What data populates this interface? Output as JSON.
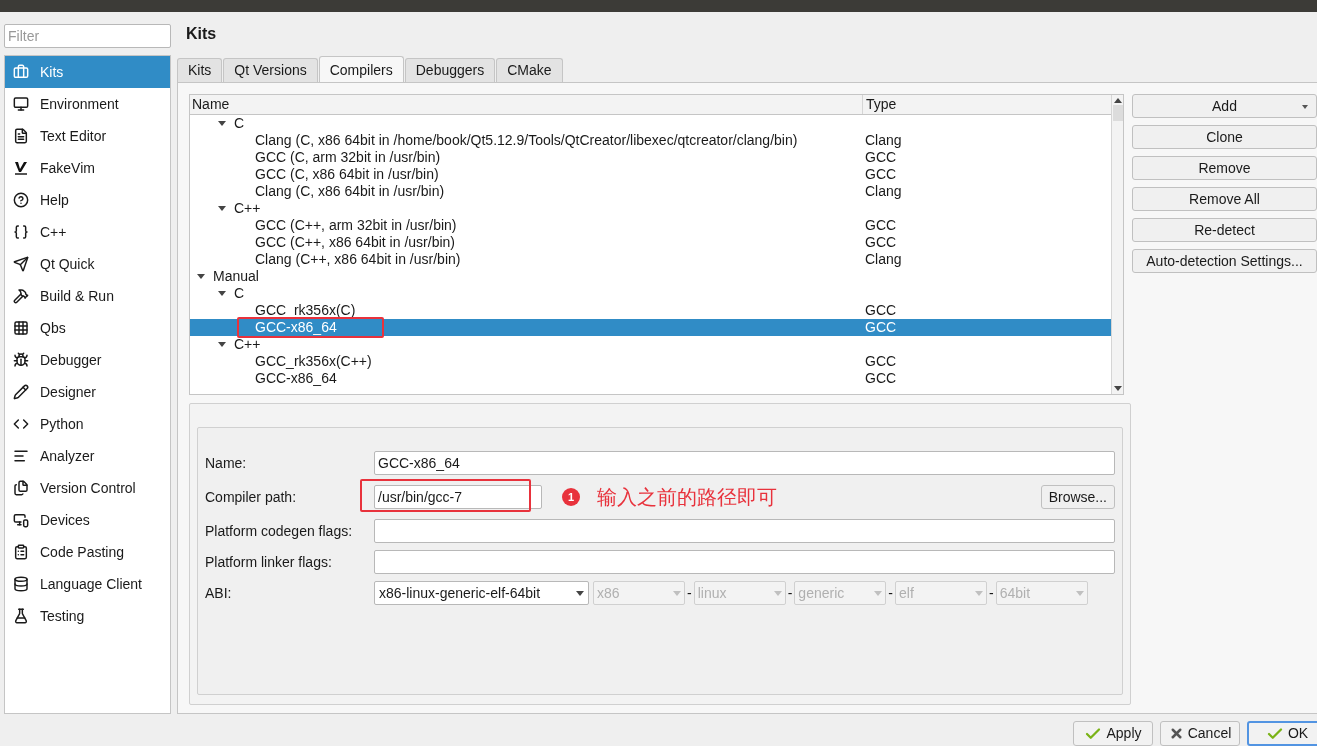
{
  "sidebar": {
    "filter": {
      "placeholder": "Filter"
    },
    "items": [
      {
        "label": "Kits",
        "selected": true
      },
      {
        "label": "Environment",
        "selected": false
      },
      {
        "label": "Text Editor",
        "selected": false
      },
      {
        "label": "FakeVim",
        "selected": false
      },
      {
        "label": "Help",
        "selected": false
      },
      {
        "label": "C++",
        "selected": false
      },
      {
        "label": "Qt Quick",
        "selected": false
      },
      {
        "label": "Build & Run",
        "selected": false
      },
      {
        "label": "Qbs",
        "selected": false
      },
      {
        "label": "Debugger",
        "selected": false
      },
      {
        "label": "Designer",
        "selected": false
      },
      {
        "label": "Python",
        "selected": false
      },
      {
        "label": "Analyzer",
        "selected": false
      },
      {
        "label": "Version Control",
        "selected": false
      },
      {
        "label": "Devices",
        "selected": false
      },
      {
        "label": "Code Pasting",
        "selected": false
      },
      {
        "label": "Language Client",
        "selected": false
      },
      {
        "label": "Testing",
        "selected": false
      }
    ]
  },
  "page_title": "Kits",
  "tabs": [
    {
      "label": "Kits",
      "selected": false
    },
    {
      "label": "Qt Versions",
      "selected": false
    },
    {
      "label": "Compilers",
      "selected": true
    },
    {
      "label": "Debuggers",
      "selected": false
    },
    {
      "label": "CMake",
      "selected": false
    }
  ],
  "tree": {
    "columns": [
      "Name",
      "Type"
    ],
    "rows": [
      {
        "children": [
          {
            "label": "C",
            "expanded": true,
            "children": [
              {
                "name": "Clang (C, x86 64bit in /home/book/Qt5.12.9/Tools/QtCreator/libexec/qtcreator/clang/bin)",
                "type": "Clang",
                "selected": false
              },
              {
                "name": "GCC (C, arm 32bit in /usr/bin)",
                "type": "GCC",
                "selected": false
              },
              {
                "name": "GCC (C, x86 64bit in /usr/bin)",
                "type": "GCC",
                "selected": false
              },
              {
                "name": "Clang (C, x86 64bit in /usr/bin)",
                "type": "Clang",
                "selected": false
              }
            ]
          },
          {
            "label": "C++",
            "expanded": true,
            "children": [
              {
                "name": "GCC (C++, arm 32bit in /usr/bin)",
                "type": "GCC",
                "selected": false
              },
              {
                "name": "GCC (C++, x86 64bit in /usr/bin)",
                "type": "GCC",
                "selected": false
              },
              {
                "name": "Clang (C++, x86 64bit in /usr/bin)",
                "type": "Clang",
                "selected": false
              }
            ]
          }
        ]
      },
      {
        "label": "Manual",
        "expanded": true,
        "children": [
          {
            "label": "C",
            "expanded": true,
            "children": [
              {
                "name": "GCC_rk356x(C)",
                "type": "GCC",
                "selected": false
              },
              {
                "name": "GCC-x86_64",
                "type": "GCC",
                "selected": true
              }
            ]
          },
          {
            "label": "C++",
            "expanded": true,
            "children": [
              {
                "name": "GCC_rk356x(C++)",
                "type": "GCC",
                "selected": false
              },
              {
                "name": "GCC-x86_64",
                "type": "GCC",
                "selected": false
              }
            ]
          }
        ]
      }
    ]
  },
  "side_buttons": [
    {
      "label": "Add",
      "kind": "menu"
    },
    {
      "label": "Clone",
      "kind": "plain"
    },
    {
      "label": "Remove",
      "kind": "plain"
    },
    {
      "label": "Remove All",
      "kind": "plain"
    },
    {
      "label": "Re-detect",
      "kind": "plain"
    },
    {
      "label": "Auto-detection Settings...",
      "kind": "plain"
    }
  ],
  "details": {
    "name": {
      "label": "Name:",
      "value": "GCC-x86_64"
    },
    "compiler_path": {
      "label": "Compiler path:",
      "value": "/usr/bin/gcc-7",
      "button": "Browse..."
    },
    "codegen_flags": {
      "label": "Platform codegen flags:"
    },
    "linker_flags": {
      "label": "Platform linker flags:"
    },
    "abi": {
      "label": "ABI:",
      "value": "x86-linux-generic-elf-64bit",
      "parts": [
        {
          "value": "x86",
          "disabled": true
        },
        {
          "separator": "-",
          "value": "linux",
          "disabled": true
        },
        {
          "separator": "-",
          "value": "generic",
          "disabled": true
        },
        {
          "separator": "-",
          "value": "elf",
          "disabled": true
        },
        {
          "separator": "-",
          "value": "64bit",
          "disabled": true
        }
      ]
    }
  },
  "annotation": {
    "badge": "1",
    "text": "输入之前的路径即可"
  },
  "dialog_buttons": [
    {
      "label": "Apply",
      "kind": "check",
      "default": false
    },
    {
      "label": "Cancel",
      "kind": "cross",
      "default": false
    },
    {
      "label": "OK",
      "kind": "check",
      "default": true
    }
  ]
}
